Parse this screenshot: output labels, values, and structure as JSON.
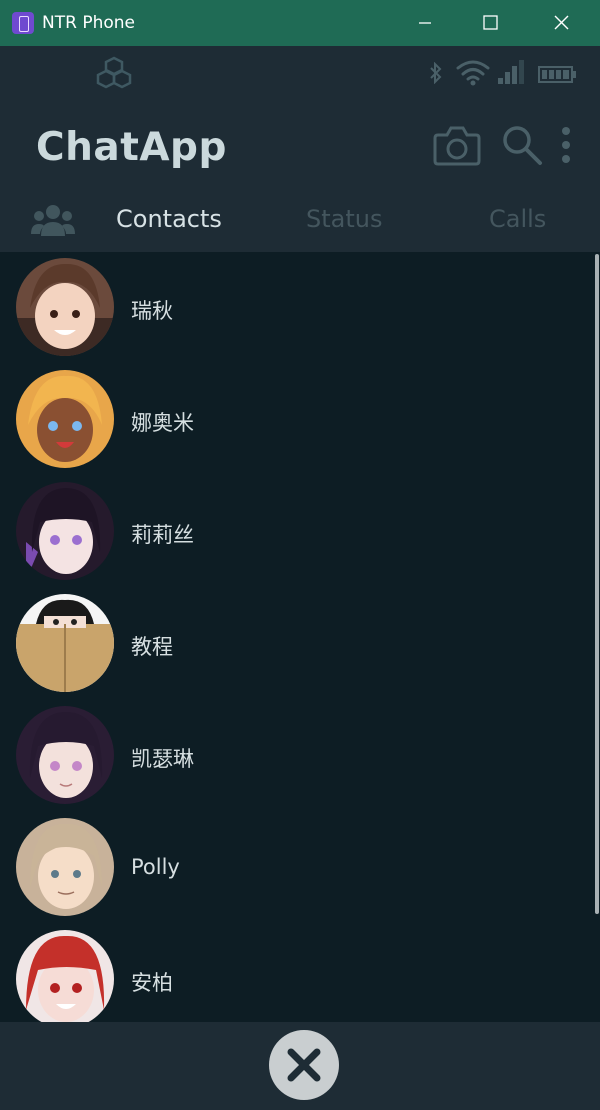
{
  "window": {
    "title": "NTR Phone",
    "controls": [
      "minimize-icon",
      "maximize-icon",
      "close-icon"
    ]
  },
  "status_bar": {
    "icons": [
      "cubes-icon",
      "bluetooth-icon",
      "wifi-icon",
      "signal-icon",
      "battery-icon"
    ]
  },
  "header": {
    "app_title": "ChatApp",
    "actions": [
      "camera-icon",
      "search-icon",
      "more-vertical-icon"
    ]
  },
  "tabs": {
    "group_icon": "group-icon",
    "items": [
      {
        "label": "Contacts",
        "active": true
      },
      {
        "label": "Status",
        "active": false
      },
      {
        "label": "Calls",
        "active": false
      }
    ]
  },
  "contacts": [
    {
      "name": "瑞秋",
      "avatar_color": "#6b4a3c",
      "hair": "#5b3a2b"
    },
    {
      "name": "娜奥米",
      "avatar_color": "#e8a64a",
      "hair": "#f2b54f"
    },
    {
      "name": "莉莉丝",
      "avatar_color": "#251a2c",
      "hair": "#1e1425"
    },
    {
      "name": "教程",
      "avatar_color": "#c9a46b",
      "hair": "#1a1a1a"
    },
    {
      "name": "凯瑟琳",
      "avatar_color": "#2a1d34",
      "hair": "#261a30"
    },
    {
      "name": "Polly",
      "avatar_color": "#c8b29a",
      "hair": "#c9b498"
    },
    {
      "name": "安柏",
      "avatar_color": "#b42a2a",
      "hair": "#c4302a"
    }
  ],
  "bottom_bar": {
    "close_icon": "close-circle-icon"
  },
  "colors": {
    "titlebar": "#1f6b55",
    "header": "#1e2c35",
    "list_background": "#0d1d24",
    "active_tab": "#d7e2e5",
    "inactive_tab": "#44565e"
  }
}
